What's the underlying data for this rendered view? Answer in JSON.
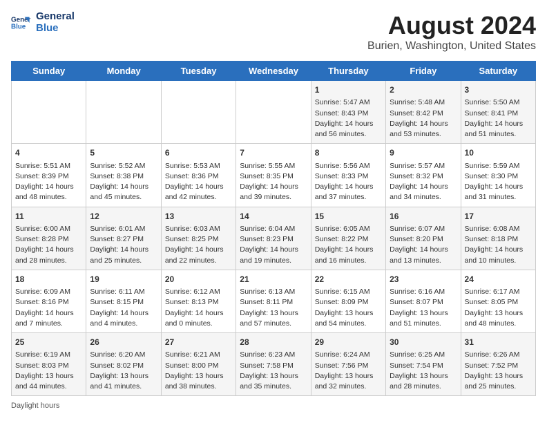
{
  "header": {
    "logo_line1": "General",
    "logo_line2": "Blue",
    "month": "August 2024",
    "location": "Burien, Washington, United States"
  },
  "days_of_week": [
    "Sunday",
    "Monday",
    "Tuesday",
    "Wednesday",
    "Thursday",
    "Friday",
    "Saturday"
  ],
  "weeks": [
    [
      {
        "day": "",
        "content": ""
      },
      {
        "day": "",
        "content": ""
      },
      {
        "day": "",
        "content": ""
      },
      {
        "day": "",
        "content": ""
      },
      {
        "day": "1",
        "content": "Sunrise: 5:47 AM\nSunset: 8:43 PM\nDaylight: 14 hours\nand 56 minutes."
      },
      {
        "day": "2",
        "content": "Sunrise: 5:48 AM\nSunset: 8:42 PM\nDaylight: 14 hours\nand 53 minutes."
      },
      {
        "day": "3",
        "content": "Sunrise: 5:50 AM\nSunset: 8:41 PM\nDaylight: 14 hours\nand 51 minutes."
      }
    ],
    [
      {
        "day": "4",
        "content": "Sunrise: 5:51 AM\nSunset: 8:39 PM\nDaylight: 14 hours\nand 48 minutes."
      },
      {
        "day": "5",
        "content": "Sunrise: 5:52 AM\nSunset: 8:38 PM\nDaylight: 14 hours\nand 45 minutes."
      },
      {
        "day": "6",
        "content": "Sunrise: 5:53 AM\nSunset: 8:36 PM\nDaylight: 14 hours\nand 42 minutes."
      },
      {
        "day": "7",
        "content": "Sunrise: 5:55 AM\nSunset: 8:35 PM\nDaylight: 14 hours\nand 39 minutes."
      },
      {
        "day": "8",
        "content": "Sunrise: 5:56 AM\nSunset: 8:33 PM\nDaylight: 14 hours\nand 37 minutes."
      },
      {
        "day": "9",
        "content": "Sunrise: 5:57 AM\nSunset: 8:32 PM\nDaylight: 14 hours\nand 34 minutes."
      },
      {
        "day": "10",
        "content": "Sunrise: 5:59 AM\nSunset: 8:30 PM\nDaylight: 14 hours\nand 31 minutes."
      }
    ],
    [
      {
        "day": "11",
        "content": "Sunrise: 6:00 AM\nSunset: 8:28 PM\nDaylight: 14 hours\nand 28 minutes."
      },
      {
        "day": "12",
        "content": "Sunrise: 6:01 AM\nSunset: 8:27 PM\nDaylight: 14 hours\nand 25 minutes."
      },
      {
        "day": "13",
        "content": "Sunrise: 6:03 AM\nSunset: 8:25 PM\nDaylight: 14 hours\nand 22 minutes."
      },
      {
        "day": "14",
        "content": "Sunrise: 6:04 AM\nSunset: 8:23 PM\nDaylight: 14 hours\nand 19 minutes."
      },
      {
        "day": "15",
        "content": "Sunrise: 6:05 AM\nSunset: 8:22 PM\nDaylight: 14 hours\nand 16 minutes."
      },
      {
        "day": "16",
        "content": "Sunrise: 6:07 AM\nSunset: 8:20 PM\nDaylight: 14 hours\nand 13 minutes."
      },
      {
        "day": "17",
        "content": "Sunrise: 6:08 AM\nSunset: 8:18 PM\nDaylight: 14 hours\nand 10 minutes."
      }
    ],
    [
      {
        "day": "18",
        "content": "Sunrise: 6:09 AM\nSunset: 8:16 PM\nDaylight: 14 hours\nand 7 minutes."
      },
      {
        "day": "19",
        "content": "Sunrise: 6:11 AM\nSunset: 8:15 PM\nDaylight: 14 hours\nand 4 minutes."
      },
      {
        "day": "20",
        "content": "Sunrise: 6:12 AM\nSunset: 8:13 PM\nDaylight: 14 hours\nand 0 minutes."
      },
      {
        "day": "21",
        "content": "Sunrise: 6:13 AM\nSunset: 8:11 PM\nDaylight: 13 hours\nand 57 minutes."
      },
      {
        "day": "22",
        "content": "Sunrise: 6:15 AM\nSunset: 8:09 PM\nDaylight: 13 hours\nand 54 minutes."
      },
      {
        "day": "23",
        "content": "Sunrise: 6:16 AM\nSunset: 8:07 PM\nDaylight: 13 hours\nand 51 minutes."
      },
      {
        "day": "24",
        "content": "Sunrise: 6:17 AM\nSunset: 8:05 PM\nDaylight: 13 hours\nand 48 minutes."
      }
    ],
    [
      {
        "day": "25",
        "content": "Sunrise: 6:19 AM\nSunset: 8:03 PM\nDaylight: 13 hours\nand 44 minutes."
      },
      {
        "day": "26",
        "content": "Sunrise: 6:20 AM\nSunset: 8:02 PM\nDaylight: 13 hours\nand 41 minutes."
      },
      {
        "day": "27",
        "content": "Sunrise: 6:21 AM\nSunset: 8:00 PM\nDaylight: 13 hours\nand 38 minutes."
      },
      {
        "day": "28",
        "content": "Sunrise: 6:23 AM\nSunset: 7:58 PM\nDaylight: 13 hours\nand 35 minutes."
      },
      {
        "day": "29",
        "content": "Sunrise: 6:24 AM\nSunset: 7:56 PM\nDaylight: 13 hours\nand 32 minutes."
      },
      {
        "day": "30",
        "content": "Sunrise: 6:25 AM\nSunset: 7:54 PM\nDaylight: 13 hours\nand 28 minutes."
      },
      {
        "day": "31",
        "content": "Sunrise: 6:26 AM\nSunset: 7:52 PM\nDaylight: 13 hours\nand 25 minutes."
      }
    ]
  ],
  "legend": {
    "daylight_label": "Daylight hours"
  }
}
